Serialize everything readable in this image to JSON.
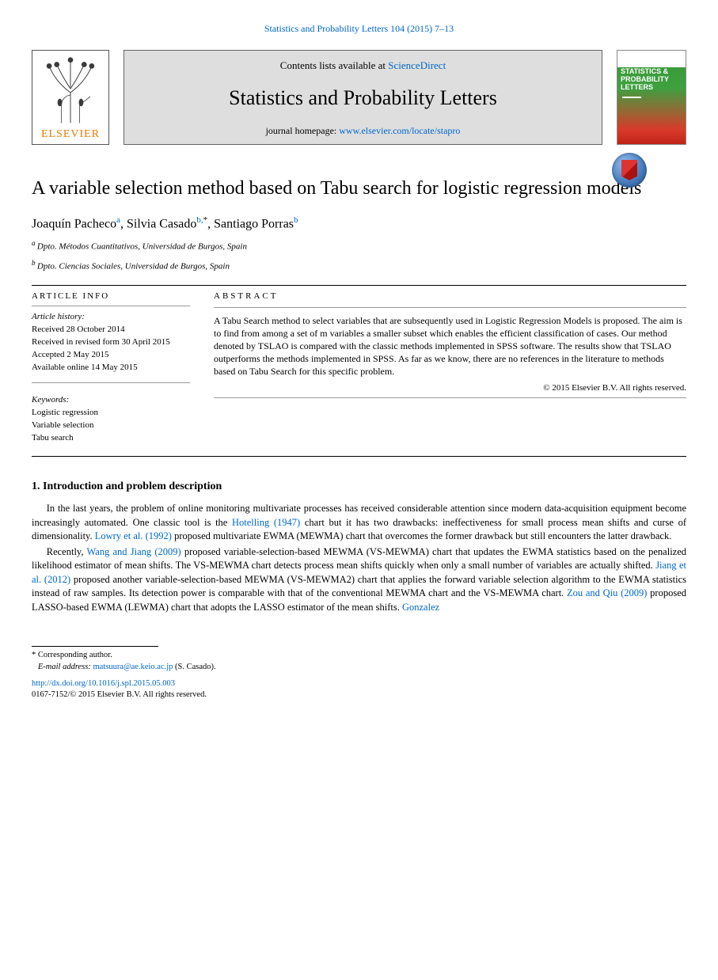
{
  "top_citation": "Statistics and Probability Letters 104 (2015) 7–13",
  "header": {
    "contents_prefix": "Contents lists available at ",
    "contents_link": "ScienceDirect",
    "journal_name": "Statistics and Probability Letters",
    "homepage_prefix": "journal homepage: ",
    "homepage_link": "www.elsevier.com/locate/stapro",
    "elsevier_word": "ELSEVIER",
    "cover_title": "STATISTICS & PROBABILITY LETTERS"
  },
  "title": "A variable selection method based on Tabu search for logistic regression models",
  "authors": {
    "a1_name": "Joaquín Pacheco",
    "a1_sup": "a",
    "a2_name": "Silvia Casado",
    "a2_sup": "b,",
    "a2_star": "*",
    "a3_name": "Santiago Porras",
    "a3_sup": "b"
  },
  "affiliations": {
    "a": "Dpto. Métodos Cuantitativos, Universidad de Burgos, Spain",
    "b": "Dpto. Ciencias Sociales, Universidad de Burgos, Spain",
    "a_sup": "a ",
    "b_sup": "b "
  },
  "article_info": {
    "head": "ARTICLE INFO",
    "history_label": "Article history:",
    "received": "Received 28 October 2014",
    "revised": "Received in revised form 30 April 2015",
    "accepted": "Accepted 2 May 2015",
    "online": "Available online 14 May 2015",
    "kw_label": "Keywords:",
    "kw1": "Logistic regression",
    "kw2": "Variable selection",
    "kw3": "Tabu search"
  },
  "abstract": {
    "head": "ABSTRACT",
    "text": "A Tabu Search method to select variables that are subsequently used in Logistic Regression Models is proposed. The aim is to find from among a set of m variables a smaller subset which enables the efficient classification of cases. Our method denoted by TSLAO is compared with the classic methods implemented in SPSS software. The results show that TSLAO outperforms the methods implemented in SPSS. As far as we know, there are no references in the literature to methods based on Tabu Search for this specific problem.",
    "copyright": "© 2015 Elsevier B.V. All rights reserved."
  },
  "section1": {
    "head": "1. Introduction and problem description",
    "p1_a": "In the last years, the problem of online monitoring multivariate processes has received considerable attention since modern data-acquisition equipment become increasingly automated. One classic tool is the ",
    "hotelling": "Hotelling (1947)",
    "p1_b": " chart but it has two drawbacks: ineffectiveness for small process mean shifts and curse of dimensionality. ",
    "lowry": "Lowry et al. (1992)",
    "p1_c": " proposed multivariate EWMA (MEWMA) chart that overcomes the former drawback but still encounters the latter drawback.",
    "p2_a": "Recently, ",
    "wang_jiang": "Wang and Jiang (2009)",
    "p2_b": " proposed variable-selection-based MEWMA (VS-MEWMA) chart that updates the EWMA statistics based on the penalized likelihood estimator of mean shifts. The VS-MEWMA chart detects process mean shifts quickly when only a small number of variables are actually shifted. ",
    "jiang2012": "Jiang et al. (2012)",
    "p2_c": " proposed another variable-selection-based MEWMA (VS-MEWMA2) chart that applies the forward variable selection algorithm to the EWMA statistics instead of raw samples. Its detection power is comparable with that of the conventional MEWMA chart and the VS-MEWMA chart. ",
    "zou_qiu": "Zou and Qiu (2009)",
    "p2_d": " proposed LASSO-based EWMA (LEWMA) chart that adopts the LASSO estimator of the mean shifts. ",
    "gonzalez": "Gonzalez"
  },
  "footnotes": {
    "corr": "* Corresponding author.",
    "email_label": "E-mail address: ",
    "email": "matsuura@ae.keio.ac.jp",
    "email_tail": " (S. Casado).",
    "doi": "http://dx.doi.org/10.1016/j.spl.2015.05.003",
    "copyright": "0167-7152/© 2015 Elsevier B.V. All rights reserved."
  }
}
